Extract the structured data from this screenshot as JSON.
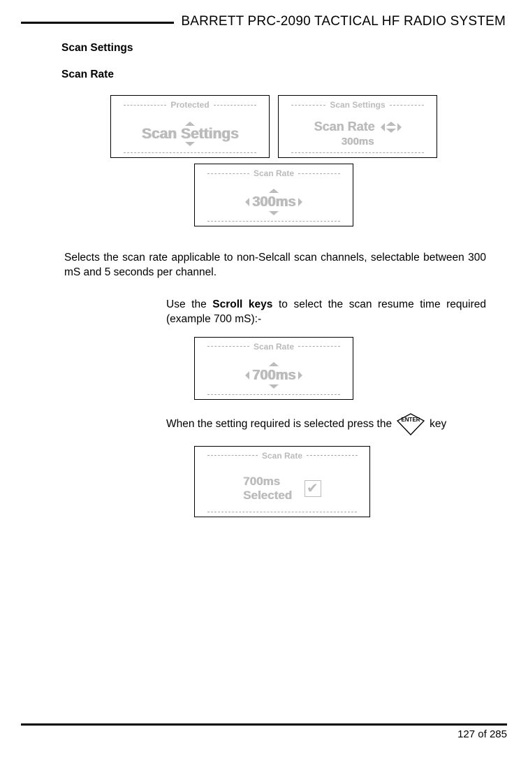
{
  "header": {
    "title": "BARRETT PRC-2090 TACTICAL HF RADIO SYSTEM"
  },
  "headings": {
    "h1": "Scan Settings",
    "h2": "Scan Rate"
  },
  "lcds": {
    "protected": {
      "title": "Protected",
      "main": "Scan Settings"
    },
    "scan_settings_rate": {
      "title": "Scan Settings",
      "line1": "Scan Rate",
      "line2": "300ms"
    },
    "scan_rate_300": {
      "title": "Scan Rate",
      "main": "300ms"
    },
    "scan_rate_700": {
      "title": "Scan Rate",
      "main": "700ms"
    },
    "scan_rate_confirm": {
      "title": "Scan Rate",
      "line1": "700ms",
      "line2": "Selected"
    }
  },
  "body": {
    "p1": "Selects the scan rate applicable to non-Selcall scan channels, selectable between 300 mS and 5 seconds per channel.",
    "p2_pre": "Use the ",
    "p2_bold": "Scroll keys",
    "p2_post": " to select the scan resume time required (example 700 mS):-",
    "p3_pre": "When the setting required is selected press the ",
    "enter_label": "ENTER",
    "p3_post": " key"
  },
  "footer": {
    "page": "127 of 285"
  }
}
